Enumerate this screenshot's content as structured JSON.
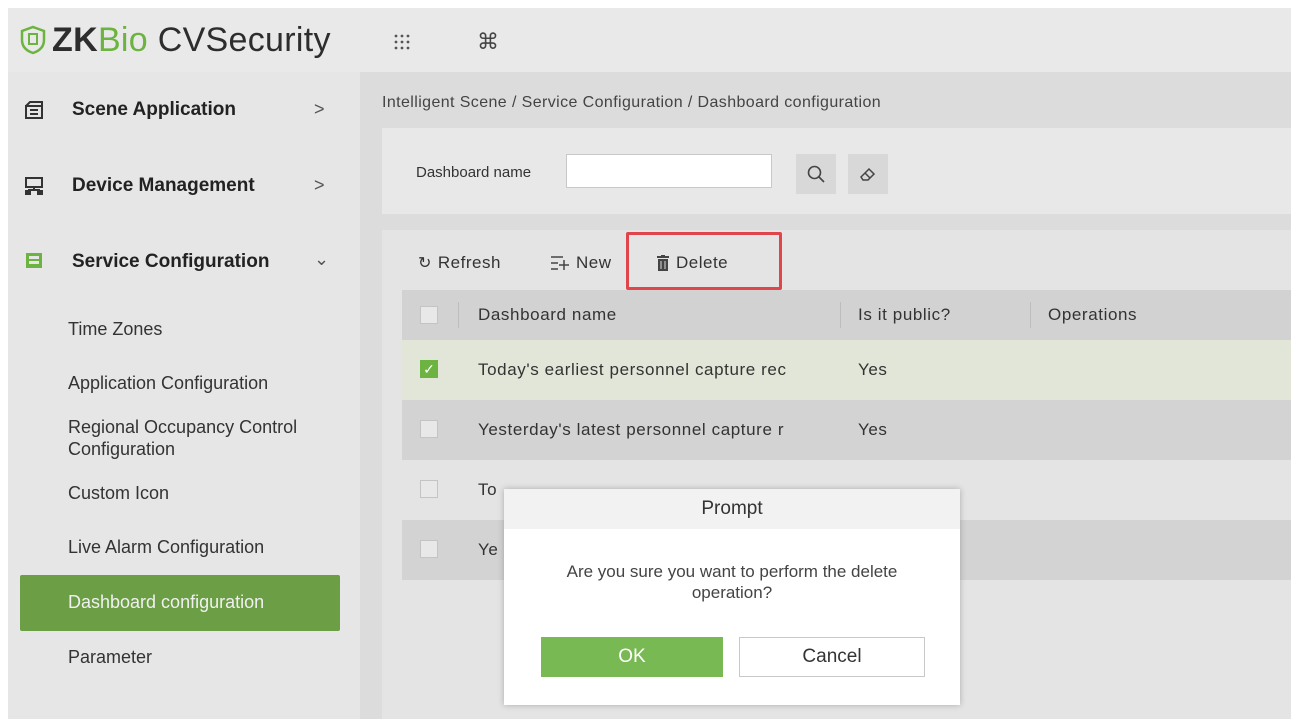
{
  "header": {
    "logo": {
      "part_zk": "ZK",
      "part_bio": "Bio",
      "part_cv": " CVSecurity"
    },
    "icons": [
      "apps-grid-icon",
      "command-icon"
    ],
    "command_glyph": "⌘"
  },
  "sidebar": {
    "menus": [
      {
        "label": "Scene Application",
        "arrow": ">",
        "icon": "scene-icon"
      },
      {
        "label": "Device Management",
        "arrow": ">",
        "icon": "device-icon"
      },
      {
        "label": "Service Configuration",
        "arrow": "⌄",
        "icon": "service-icon"
      }
    ],
    "submenu": [
      "Time Zones",
      "Application Configuration",
      "Regional Occupancy Control Configuration",
      "Custom Icon",
      "Live Alarm Configuration",
      "Dashboard configuration",
      "Parameter"
    ],
    "active_index": 5,
    "active_color": "#6c9e46"
  },
  "breadcrumb": "Intelligent Scene / Service Configuration / Dashboard configuration",
  "filter": {
    "label": "Dashboard name",
    "value": ""
  },
  "toolbar": {
    "refresh": "Refresh",
    "new": "New",
    "delete": "Delete",
    "highlight_color": "#e0454b"
  },
  "table": {
    "headers": [
      "Dashboard name",
      "Is it public?",
      "Operations"
    ],
    "rows": [
      {
        "name": "Today's earliest personnel capture rec",
        "public": "Yes",
        "checked": true
      },
      {
        "name": "Yesterday's latest personnel capture r",
        "public": "Yes",
        "checked": false
      },
      {
        "name": "To",
        "public": "",
        "checked": false
      },
      {
        "name": "Ye",
        "public": "",
        "checked": false
      }
    ]
  },
  "dialog": {
    "title": "Prompt",
    "message_line1": "Are you sure you want to perform the delete",
    "message_line2": "operation?",
    "ok": "OK",
    "cancel": "Cancel",
    "ok_color": "#79b953"
  }
}
